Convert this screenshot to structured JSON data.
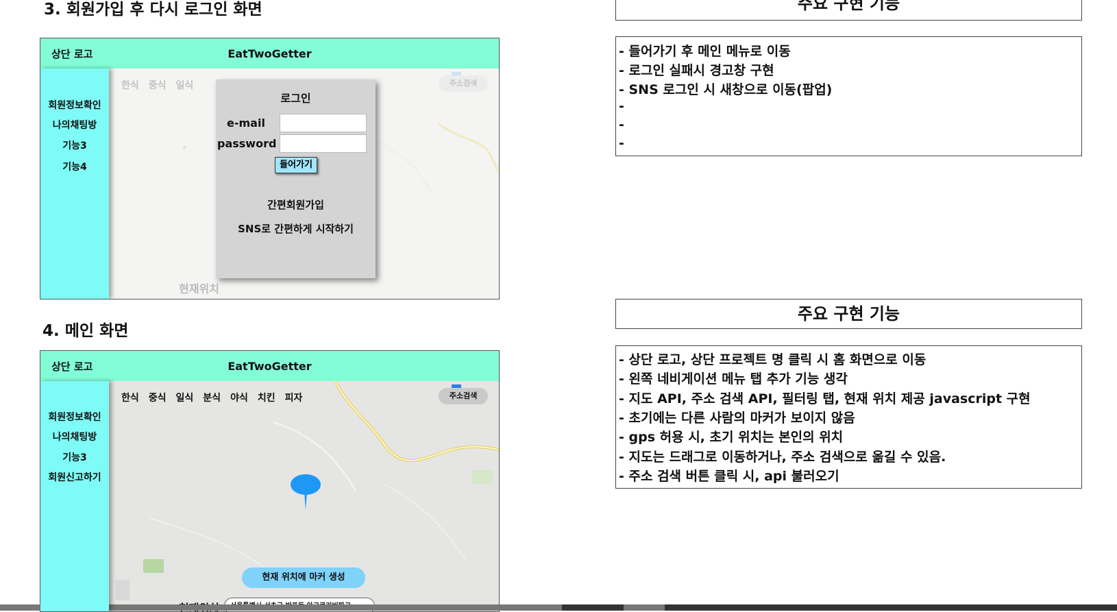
{
  "section3": {
    "title": "3. 회원가입 후 다시 로그인 화면",
    "header": {
      "logo": "상단 로고",
      "brand": "EatTwoGetter"
    },
    "nav": [
      "회원정보확인",
      "나의채팅방",
      "기능3",
      "기능4"
    ],
    "filters": [
      "한식",
      "중식",
      "일식"
    ],
    "address_button": "주소검색",
    "location_label": "현재위치",
    "login": {
      "title": "로그인",
      "email_label": "e-mail",
      "password_label": "password",
      "submit_label": "들어가기",
      "quick_signup": "간편회원가입",
      "sns_start": "SNS로 간편하게 시작하기"
    }
  },
  "section4": {
    "title": "4. 메인 화면",
    "header": {
      "logo": "상단 로고",
      "brand": "EatTwoGetter"
    },
    "nav": [
      "회원정보확인",
      "나의채팅방",
      "기능3",
      "회원신고하기"
    ],
    "filters": [
      "한식",
      "중식",
      "일식",
      "분식",
      "야식",
      "치킨",
      "피자"
    ],
    "address_button": "주소검색",
    "marker_button": "현재 위치에 마커 생성",
    "location_label": "현재위치",
    "location_value": "서울특별시 서초구 반포동 아크로리버파크"
  },
  "features_top": {
    "header": "주요 구현 기능",
    "items": [
      "- 들어가기 후 메인 메뉴로 이동",
      "- 로그인 실패시 경고창 구현",
      "- SNS 로그인 시 새창으로 이동(팝업)",
      "-",
      "-",
      "-"
    ]
  },
  "features_bottom": {
    "header": "주요 구현 기능",
    "items": [
      "- 상단 로고, 상단 프로젝트 명 클릭 시 홈 화면으로 이동",
      "- 왼쪽 네비게이션 메뉴 탭 추가 기능 생각",
      "- 지도 API, 주소 검색 API, 필터링 탭, 현재 위치 제공 javascript 구현",
      "- 초기에는 다른 사람의 마커가 보이지 않음",
      "- gps 허용 시, 초기 위치는 본인의 위치",
      "- 지도는 드래그로 이동하거나, 주소 검색으로 옮길 수 있음.",
      "- 주소 검색 버튼 클릭 시, api 불러오기"
    ]
  },
  "colors": {
    "header_green": "#82fdd6",
    "nav_cyan": "#7efbf6",
    "marker_blue": "#1e98f5",
    "button_blue": "#7fd3fb"
  }
}
